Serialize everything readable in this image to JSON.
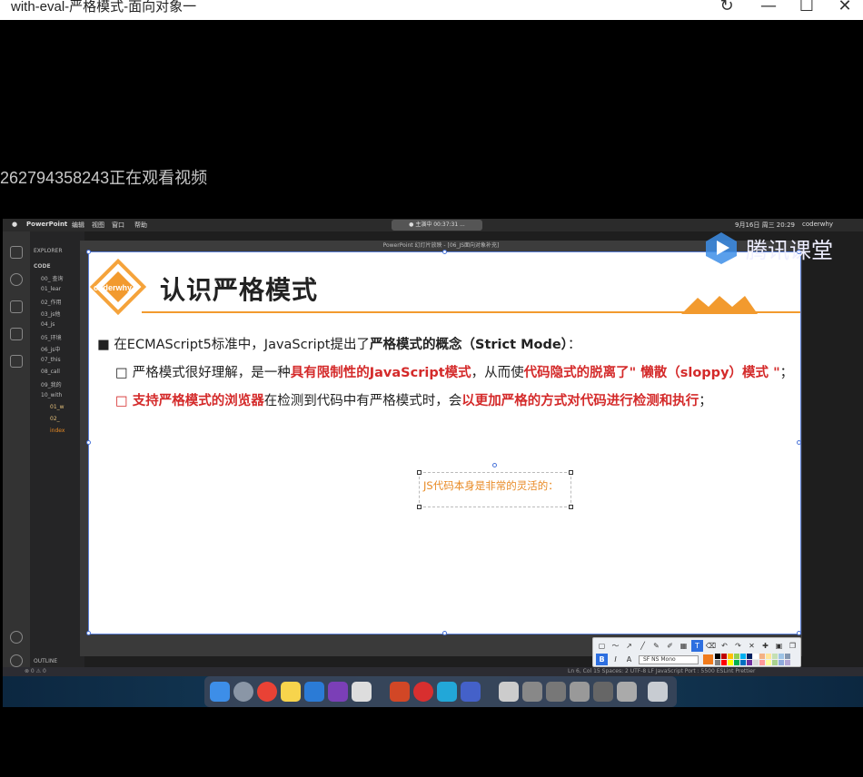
{
  "window": {
    "title": "with-eval-严格模式-面向对象一"
  },
  "watermark": "262794358243正在观看视频",
  "mac": {
    "menu": {
      "app": "PowerPoint",
      "items": [
        "编辑",
        "视图",
        "窗口",
        "帮助"
      ],
      "clock": "9月16日 周三 20:29",
      "user": "coderwhy",
      "recording": "● 主演中 00:37:31 ..."
    },
    "vscode": {
      "explorer_label": "EXPLORER",
      "section": "CODE",
      "items": [
        "00_ 查询",
        "01_lear",
        "02_作用",
        "03_js他",
        "04_js",
        "05_环境",
        "06_js中",
        "07_this",
        "08_call",
        "09_我的",
        "10_with",
        "01_w",
        "02_",
        "index"
      ],
      "outline": "OUTLINE",
      "status_left": "⊗ 0 ⚠ 0",
      "status_right": "Ln 6, Col 15   Spaces: 2   UTF-8   LF   JavaScript   Port : 5500   ESLint   Prettier"
    },
    "ppt_title": "PowerPoint 幻灯片放映 - [06_JS面向对象补充]"
  },
  "brand": {
    "tencent": "腾讯课堂"
  },
  "slide": {
    "logo": "coderwhy",
    "title": "认识严格模式",
    "line1": {
      "a": "在ECMAScript5标准中，JavaScript提出了",
      "b": "严格模式的概念（Strict Mode）",
      "c": "："
    },
    "line2": {
      "a": "严格模式很好理解，是一种",
      "b": "具有限制性的JavaScript模式",
      "c": "，从而使",
      "d": "代码隐式的脱离了\" 懒散（sloppy）模式 \"",
      "e": "；"
    },
    "line3": {
      "a": "支持严格模式的浏览器",
      "b": "在检测到代码中有严格模式时，会",
      "c": "以更加严格的方式对代码进行检测和执行",
      "d": "；"
    },
    "textbox": "JS代码本身是非常的灵活的："
  },
  "toolbar": {
    "font": "SF NS Mono",
    "colors": [
      "#000000",
      "#7f7f7f",
      "#c00000",
      "#ff0000",
      "#ffc000",
      "#ffff00",
      "#92d050",
      "#00b050",
      "#00b0f0",
      "#0070c0",
      "#002060",
      "#7030a0",
      "#ffffff",
      "#d9d9d9",
      "#f4b183",
      "#ff9999",
      "#ffe699",
      "#ffff99",
      "#c5e0b4",
      "#a9d18e",
      "#9dc3e6",
      "#8faadc",
      "#8497b0",
      "#b4a7d6"
    ]
  }
}
